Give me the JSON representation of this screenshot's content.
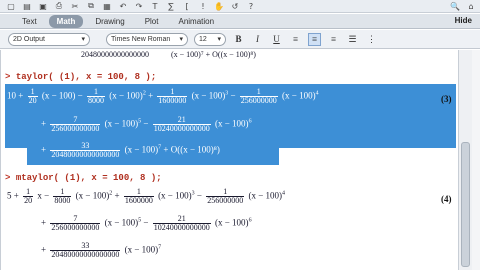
{
  "toolbar": {
    "icons": [
      "new-icon",
      "open-icon",
      "save-icon",
      "print-icon",
      "cut-icon",
      "copy-icon",
      "paste-icon",
      "undo-icon",
      "redo-icon",
      "text-icon",
      "math-icon",
      "bracket-icon",
      "exec-icon",
      "stop-icon",
      "restart-icon",
      "help-icon"
    ]
  },
  "tabs": {
    "text": "Text",
    "math": "Math",
    "drawing": "Drawing",
    "plot": "Plot",
    "animation": "Animation",
    "hide": "Hide"
  },
  "format": {
    "style_select": "2D Output",
    "font_select": "Times New Roman",
    "size_select": "12",
    "bold": "B",
    "italic": "I",
    "underline": "U"
  },
  "doc": {
    "top_partial": "20480000000000000",
    "top_tail": "(x − 100)⁷ + O((x − 100)⁸)",
    "cmd1_prompt": ">",
    "cmd1": "taylor( (1), x = 100, 8 );",
    "cmd2_prompt": ">",
    "cmd2": "mtaylor( (1), x = 100, 8 );",
    "eq3": "(3)",
    "eq4": "(4)",
    "res3_line1_lead": "10 +",
    "res3_f1_num": "1",
    "res3_f1_den": "20",
    "res3_f2_num": "1",
    "res3_f2_den": "8000",
    "res3_f3_num": "1",
    "res3_f3_den": "1600000",
    "res3_f4_num": "1",
    "res3_f4_den": "256000000",
    "res3_f5_num": "7",
    "res3_f5_den": "256000000000",
    "res3_f6_num": "21",
    "res3_f6_den": "10240000000000",
    "res3_f7_num": "33",
    "res3_f7_den": "20480000000000000",
    "term_x100": "(x − 100)",
    "res4_line1_lead": "5 +",
    "res4_x": "x −",
    "big_o": "+ O((x − 100)⁸)"
  }
}
